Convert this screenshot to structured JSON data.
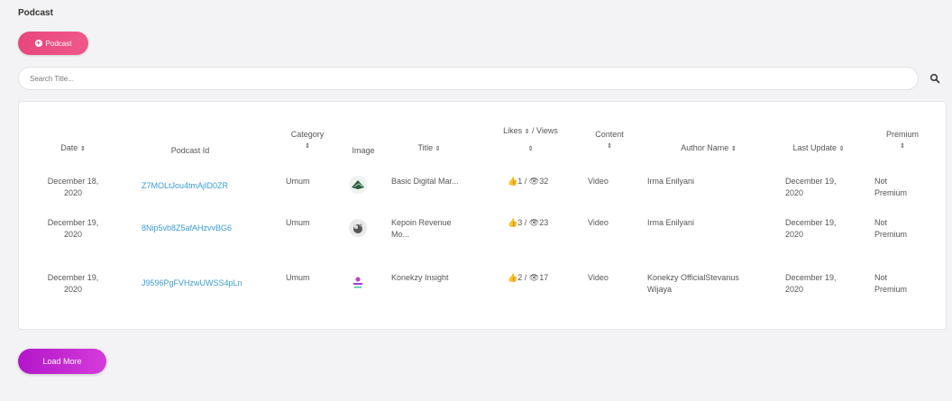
{
  "page": {
    "title": "Podcast"
  },
  "toolbar": {
    "add_label": "Podcast"
  },
  "search": {
    "placeholder": "Search Title..."
  },
  "table": {
    "headers": {
      "date": "Date",
      "podcast_id": "Podcast Id",
      "category": "Category",
      "image": "Image",
      "title": "Title",
      "likes": "Likes",
      "views": "/ Views",
      "content": "Content",
      "author": "Author Name",
      "last_update": "Last Update",
      "premium": "Premium"
    },
    "sort_glyph": "⇕",
    "rows": [
      {
        "date_line1": "December 18,",
        "date_line2": "2020",
        "podcast_id": "Z7MOLtJou4tmAjID0ZR",
        "category": "Umum",
        "title": "Basic Digital Mar...",
        "title_line2": "",
        "likes": "1",
        "views": "32",
        "content": "Video",
        "author": "Irma Enilyani",
        "author_line2": "",
        "last_update_line1": "December 19,",
        "last_update_line2": "2020",
        "premium_line1": "Not",
        "premium_line2": "Premium"
      },
      {
        "date_line1": "December 19,",
        "date_line2": "2020",
        "podcast_id": "8Nip5vb8Z5afAHzvvBG6",
        "category": "Umum",
        "title": "Kepoin Revenue",
        "title_line2": "Mo...",
        "likes": "3",
        "views": "23",
        "content": "Video",
        "author": "Irma Enilyani",
        "author_line2": "",
        "last_update_line1": "December 19,",
        "last_update_line2": "2020",
        "premium_line1": "Not",
        "premium_line2": "Premium"
      },
      {
        "date_line1": "December 19,",
        "date_line2": "2020",
        "podcast_id": "J9596PgFVHzwUWSS4pLn",
        "category": "Umum",
        "title": "Konekzy Insight",
        "title_line2": "",
        "likes": "2",
        "views": "17",
        "content": "Video",
        "author": "Konekzy OfficialStevanus",
        "author_line2": "Wijaya",
        "last_update_line1": "December 19,",
        "last_update_line2": "2020",
        "premium_line1": "Not",
        "premium_line2": "Premium"
      }
    ]
  },
  "footer": {
    "load_more_label": "Load More"
  },
  "colors": {
    "add_button": "#e8467c",
    "load_more_button": "#b316c9",
    "link": "#3a9bd9",
    "background": "#f3f3f5"
  },
  "icons": {
    "add": "plus-circle-icon",
    "search": "search-icon",
    "sort": "sort-icon",
    "likes": "thumbs-up-icon",
    "views": "eye-icon"
  }
}
